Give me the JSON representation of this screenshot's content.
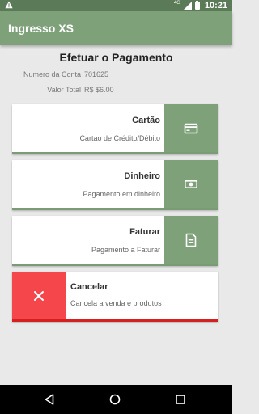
{
  "status_bar": {
    "network": "4G",
    "time": "10:21"
  },
  "app_bar": {
    "title": "Ingresso XS"
  },
  "page": {
    "title": "Efetuar o Pagamento",
    "account_label": "Numero da Conta",
    "account_value": "701625",
    "total_label": "Valor Total",
    "total_value": "R$ $6.00"
  },
  "options": [
    {
      "title": "Cartão",
      "subtitle": "Cartao de Crédito/Débito",
      "icon": "credit-card-icon"
    },
    {
      "title": "Dinheiro",
      "subtitle": "Pagamento em dinheiro",
      "icon": "cash-icon"
    },
    {
      "title": "Faturar",
      "subtitle": "Pagamento a Faturar",
      "icon": "invoice-icon"
    }
  ],
  "cancel": {
    "title": "Cancelar",
    "subtitle": "Cancela a venda e produtos",
    "icon": "close-icon"
  },
  "colors": {
    "primary": "#7ea17a",
    "status_bar": "#5b7a57",
    "danger": "#f5464b",
    "danger_border": "#d61f1f"
  },
  "nav": {
    "back_icon": "back-triangle-icon",
    "home_icon": "home-circle-icon",
    "recents_icon": "recents-square-icon"
  }
}
